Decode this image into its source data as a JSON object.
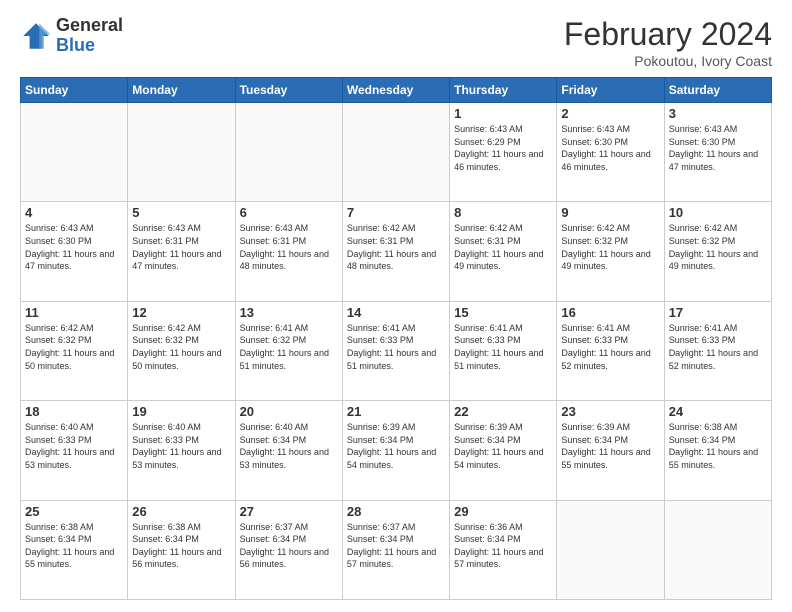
{
  "logo": {
    "general": "General",
    "blue": "Blue"
  },
  "header": {
    "month": "February 2024",
    "location": "Pokoutou, Ivory Coast"
  },
  "weekdays": [
    "Sunday",
    "Monday",
    "Tuesday",
    "Wednesday",
    "Thursday",
    "Friday",
    "Saturday"
  ],
  "weeks": [
    [
      {
        "day": "",
        "info": ""
      },
      {
        "day": "",
        "info": ""
      },
      {
        "day": "",
        "info": ""
      },
      {
        "day": "",
        "info": ""
      },
      {
        "day": "1",
        "info": "Sunrise: 6:43 AM\nSunset: 6:29 PM\nDaylight: 11 hours and 46 minutes."
      },
      {
        "day": "2",
        "info": "Sunrise: 6:43 AM\nSunset: 6:30 PM\nDaylight: 11 hours and 46 minutes."
      },
      {
        "day": "3",
        "info": "Sunrise: 6:43 AM\nSunset: 6:30 PM\nDaylight: 11 hours and 47 minutes."
      }
    ],
    [
      {
        "day": "4",
        "info": "Sunrise: 6:43 AM\nSunset: 6:30 PM\nDaylight: 11 hours and 47 minutes."
      },
      {
        "day": "5",
        "info": "Sunrise: 6:43 AM\nSunset: 6:31 PM\nDaylight: 11 hours and 47 minutes."
      },
      {
        "day": "6",
        "info": "Sunrise: 6:43 AM\nSunset: 6:31 PM\nDaylight: 11 hours and 48 minutes."
      },
      {
        "day": "7",
        "info": "Sunrise: 6:42 AM\nSunset: 6:31 PM\nDaylight: 11 hours and 48 minutes."
      },
      {
        "day": "8",
        "info": "Sunrise: 6:42 AM\nSunset: 6:31 PM\nDaylight: 11 hours and 49 minutes."
      },
      {
        "day": "9",
        "info": "Sunrise: 6:42 AM\nSunset: 6:32 PM\nDaylight: 11 hours and 49 minutes."
      },
      {
        "day": "10",
        "info": "Sunrise: 6:42 AM\nSunset: 6:32 PM\nDaylight: 11 hours and 49 minutes."
      }
    ],
    [
      {
        "day": "11",
        "info": "Sunrise: 6:42 AM\nSunset: 6:32 PM\nDaylight: 11 hours and 50 minutes."
      },
      {
        "day": "12",
        "info": "Sunrise: 6:42 AM\nSunset: 6:32 PM\nDaylight: 11 hours and 50 minutes."
      },
      {
        "day": "13",
        "info": "Sunrise: 6:41 AM\nSunset: 6:32 PM\nDaylight: 11 hours and 51 minutes."
      },
      {
        "day": "14",
        "info": "Sunrise: 6:41 AM\nSunset: 6:33 PM\nDaylight: 11 hours and 51 minutes."
      },
      {
        "day": "15",
        "info": "Sunrise: 6:41 AM\nSunset: 6:33 PM\nDaylight: 11 hours and 51 minutes."
      },
      {
        "day": "16",
        "info": "Sunrise: 6:41 AM\nSunset: 6:33 PM\nDaylight: 11 hours and 52 minutes."
      },
      {
        "day": "17",
        "info": "Sunrise: 6:41 AM\nSunset: 6:33 PM\nDaylight: 11 hours and 52 minutes."
      }
    ],
    [
      {
        "day": "18",
        "info": "Sunrise: 6:40 AM\nSunset: 6:33 PM\nDaylight: 11 hours and 53 minutes."
      },
      {
        "day": "19",
        "info": "Sunrise: 6:40 AM\nSunset: 6:33 PM\nDaylight: 11 hours and 53 minutes."
      },
      {
        "day": "20",
        "info": "Sunrise: 6:40 AM\nSunset: 6:34 PM\nDaylight: 11 hours and 53 minutes."
      },
      {
        "day": "21",
        "info": "Sunrise: 6:39 AM\nSunset: 6:34 PM\nDaylight: 11 hours and 54 minutes."
      },
      {
        "day": "22",
        "info": "Sunrise: 6:39 AM\nSunset: 6:34 PM\nDaylight: 11 hours and 54 minutes."
      },
      {
        "day": "23",
        "info": "Sunrise: 6:39 AM\nSunset: 6:34 PM\nDaylight: 11 hours and 55 minutes."
      },
      {
        "day": "24",
        "info": "Sunrise: 6:38 AM\nSunset: 6:34 PM\nDaylight: 11 hours and 55 minutes."
      }
    ],
    [
      {
        "day": "25",
        "info": "Sunrise: 6:38 AM\nSunset: 6:34 PM\nDaylight: 11 hours and 55 minutes."
      },
      {
        "day": "26",
        "info": "Sunrise: 6:38 AM\nSunset: 6:34 PM\nDaylight: 11 hours and 56 minutes."
      },
      {
        "day": "27",
        "info": "Sunrise: 6:37 AM\nSunset: 6:34 PM\nDaylight: 11 hours and 56 minutes."
      },
      {
        "day": "28",
        "info": "Sunrise: 6:37 AM\nSunset: 6:34 PM\nDaylight: 11 hours and 57 minutes."
      },
      {
        "day": "29",
        "info": "Sunrise: 6:36 AM\nSunset: 6:34 PM\nDaylight: 11 hours and 57 minutes."
      },
      {
        "day": "",
        "info": ""
      },
      {
        "day": "",
        "info": ""
      }
    ]
  ]
}
